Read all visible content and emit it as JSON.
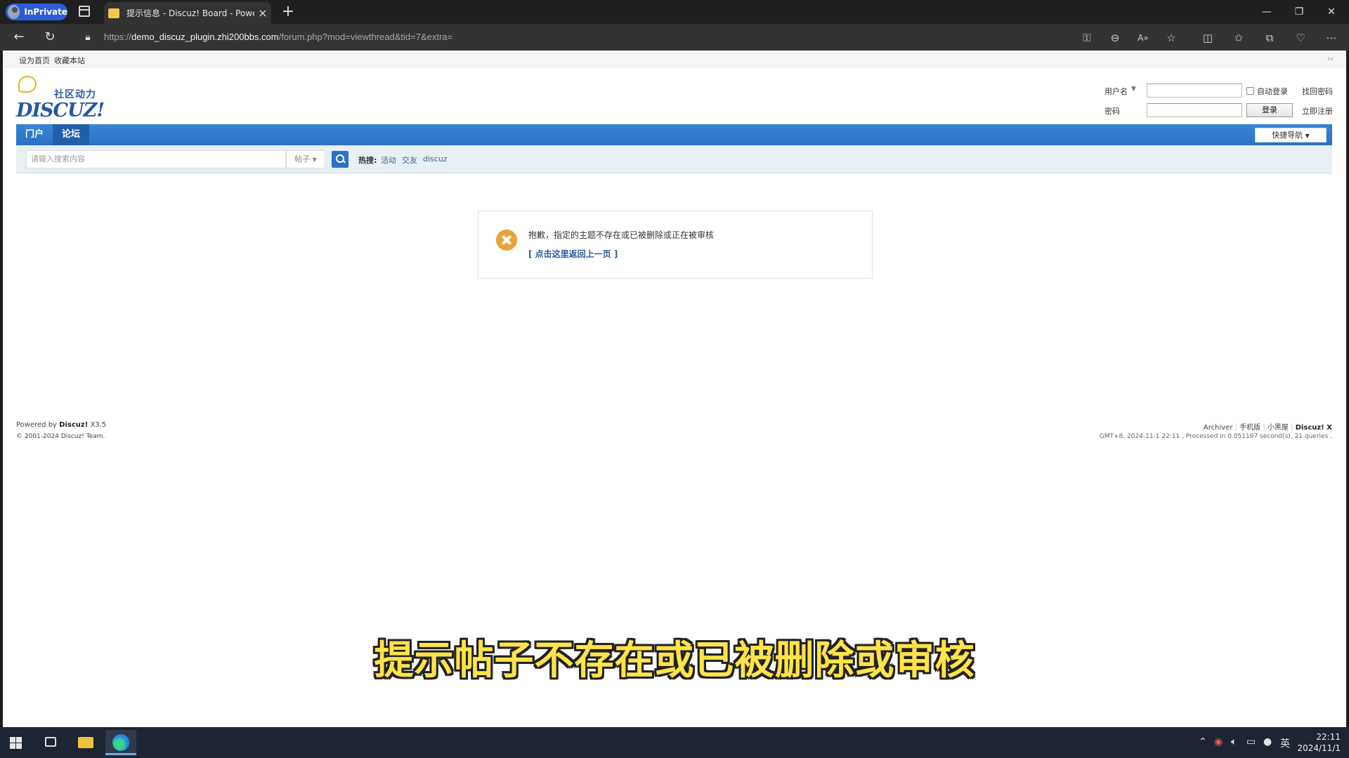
{
  "browser": {
    "inprivate_label": "InPrivate",
    "tab_title": "提示信息 - Discuz! Board - Powered",
    "url_prefix": "https://",
    "url_host": "demo_discuz_plugin.zhi200bbs.com",
    "url_path": "/forum.php?mod=viewthread&tid=7&extra="
  },
  "topbar": {
    "set_home": "设为首页",
    "bookmark": "收藏本站",
    "collapse": "›‹"
  },
  "logo": {
    "slogan": "社区动力",
    "wordmark": "DISCUZ!"
  },
  "login": {
    "username_label": "用户名",
    "password_label": "密码",
    "auto_login": "自动登录",
    "forgot_password": "找回密码",
    "login_button": "登录",
    "register": "立即注册"
  },
  "nav": {
    "items": [
      {
        "label": "门户"
      },
      {
        "label": "论坛"
      }
    ],
    "quick_nav": "快捷导航"
  },
  "search": {
    "placeholder": "请输入搜索内容",
    "type": "帖子",
    "hot_label": "热搜:",
    "hot_terms": [
      "活动",
      "交友",
      "discuz"
    ]
  },
  "message": {
    "text": "抱歉，指定的主题不存在或已被删除或正在被审核",
    "back_link": "[ 点击这里返回上一页 ]"
  },
  "footer": {
    "powered_prefix": "Powered by",
    "powered_brand": "Discuz!",
    "powered_version": "X3.5",
    "copyright": "© 2001-2024 Discuz! Team.",
    "links": [
      "Archiver",
      "手机版",
      "小黑屋"
    ],
    "brand_right": "Discuz! X",
    "stats": "GMT+8, 2024-11-1 22:11 , Processed in 0.051197 second(s), 21 queries ."
  },
  "subtitle": "提示帖子不存在或已被删除或审核",
  "taskbar": {
    "ime": "英",
    "time": "22:11",
    "date": "2024/11/1"
  },
  "colors": {
    "nav_blue": "#2b7acd",
    "error_orange": "#e9a13a",
    "subtitle_yellow": "#ffe34a"
  }
}
